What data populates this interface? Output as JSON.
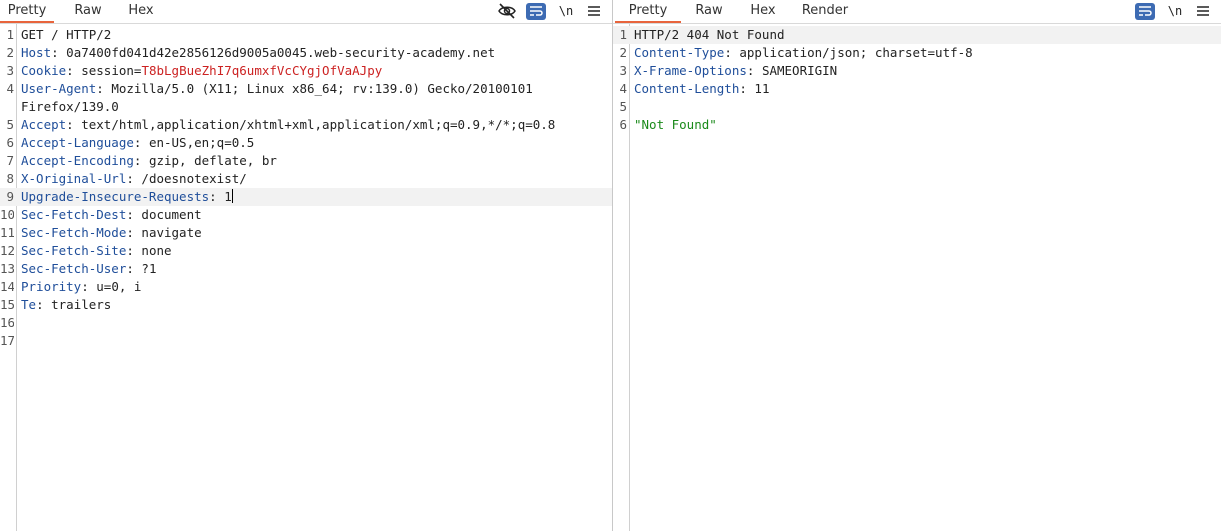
{
  "request": {
    "tabs": [
      "Pretty",
      "Raw",
      "Hex"
    ],
    "active_tab": "Pretty",
    "toolbar": {
      "newline_label": "\\n"
    },
    "lines": [
      {
        "n": "1",
        "plain": "GET / HTTP/2"
      },
      {
        "n": "2",
        "key": "Host",
        "val": "0a7400fd041d42e2856126d9005a0045.web-security-academy.net"
      },
      {
        "n": "3",
        "key": "Cookie",
        "val": "session=",
        "cookie": "T8bLgBueZhI7q6umxfVcCYgjOfVaAJpy"
      },
      {
        "n": "4",
        "key": "User-Agent",
        "val": "Mozilla/5.0 (X11; Linux x86_64; rv:139.0) Gecko/20100101"
      },
      {
        "n": "",
        "plain": "Firefox/139.0"
      },
      {
        "n": "5",
        "key": "Accept",
        "val": "text/html,application/xhtml+xml,application/xml;q=0.9,*/*;q=0.8"
      },
      {
        "n": "6",
        "key": "Accept-Language",
        "val": "en-US,en;q=0.5"
      },
      {
        "n": "7",
        "key": "Accept-Encoding",
        "val": "gzip, deflate, br"
      },
      {
        "n": "8",
        "key": "X-Original-Url",
        "val": "/doesnotexist/"
      },
      {
        "n": "9",
        "key": "Upgrade-Insecure-Requests",
        "val": "1"
      },
      {
        "n": "10",
        "key": "Sec-Fetch-Dest",
        "val": "document"
      },
      {
        "n": "11",
        "key": "Sec-Fetch-Mode",
        "val": "navigate"
      },
      {
        "n": "12",
        "key": "Sec-Fetch-Site",
        "val": "none"
      },
      {
        "n": "13",
        "key": "Sec-Fetch-User",
        "val": "?1"
      },
      {
        "n": "14",
        "key": "Priority",
        "val": "u=0, i"
      },
      {
        "n": "15",
        "key": "Te",
        "val": "trailers"
      },
      {
        "n": "16",
        "plain": ""
      },
      {
        "n": "17",
        "plain": ""
      }
    ]
  },
  "response": {
    "tabs": [
      "Pretty",
      "Raw",
      "Hex",
      "Render"
    ],
    "active_tab": "Pretty",
    "toolbar": {
      "newline_label": "\\n"
    },
    "lines": [
      {
        "n": "1",
        "plain": "HTTP/2 404 Not Found"
      },
      {
        "n": "2",
        "key": "Content-Type",
        "val": "application/json; charset=utf-8"
      },
      {
        "n": "3",
        "key": "X-Frame-Options",
        "val": "SAMEORIGIN"
      },
      {
        "n": "4",
        "key": "Content-Length",
        "val": "11"
      },
      {
        "n": "5",
        "plain": ""
      },
      {
        "n": "6",
        "str": "\"Not Found\""
      }
    ]
  }
}
